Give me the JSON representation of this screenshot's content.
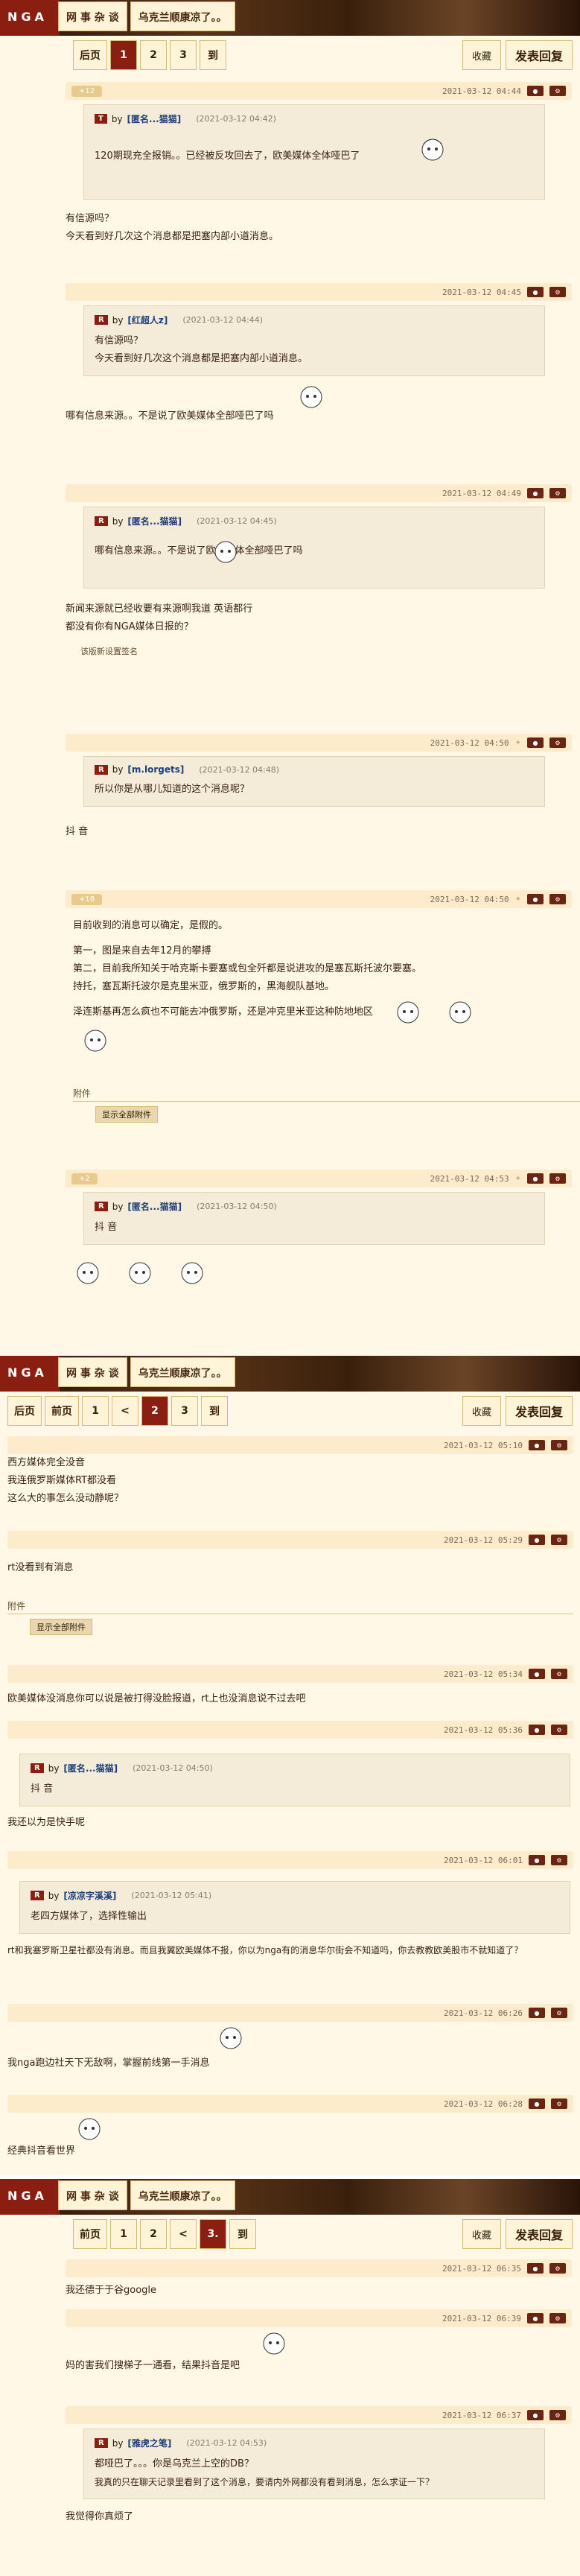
{
  "header": {
    "logo": "NGA",
    "breadcrumbs": [
      "网 事 杂 谈",
      "乌克兰顺康凉了。。"
    ]
  },
  "toolbar": {
    "fav": "收藏",
    "reply": "发表回复"
  },
  "pages": [
    {
      "items": [
        "后页",
        "1",
        "2",
        "3",
        "到"
      ],
      "current": "1"
    },
    {
      "items": [
        "后页",
        "前页",
        "1",
        "<",
        "2",
        "3",
        "到"
      ],
      "current": "2"
    },
    {
      "items": [
        "前页",
        "1",
        "2",
        "<",
        "3.",
        "到"
      ],
      "current": "3."
    }
  ],
  "posts": {
    "p1": {
      "tag": "+12",
      "ts": "2021-03-12 04:44",
      "quote_user": "[匿名...猫猫]",
      "quote_ts": "(2021-03-12 04:42)",
      "quote_text": "120期现充全报销。。已经被反攻回去了，欧美媒体全体哑巴了",
      "text1": "有信源吗？",
      "text2": "今天看到好几次这个消息都是把塞内部小道消息。"
    },
    "p2": {
      "ts": "2021-03-12 04:45",
      "quote_user": "[红超人z]",
      "quote_ts": "(2021-03-12 04:44)",
      "quote_text1": "有信源吗？",
      "quote_text2": "今天看到好几次这个消息都是把塞内部小道消息。",
      "text": "哪有信息来源。。不是说了欧美媒体全部哑巴了吗"
    },
    "p3": {
      "ts": "2021-03-12 04:49",
      "quote_user": "[匿名...猫猫]",
      "quote_ts": "(2021-03-12 04:45)",
      "quote_text": "哪有信息来源。。不是说了欧美媒体全部哑巴了吗",
      "text1": "新闻来源就已经收要有来源啊我道 英语都行",
      "text2": "都没有你有NGA媒体日报的？",
      "sig": "该版新设置签名"
    },
    "p4": {
      "ts": "2021-03-12 04:50",
      "quote_user": "[m.lorgets]",
      "quote_ts": "(2021-03-12 04:48)",
      "quote_text": "所以你是从哪儿知道的这个消息呢？",
      "text": "抖 音"
    },
    "p5": {
      "tag": "+18",
      "ts": "2021-03-12 04:50",
      "text1": "目前收到的消息可以确定，是假的。",
      "text2": "第一，图是来自去年12月的攀搏",
      "text3": "第二，目前我所知关于哈克斯卡要塞或包全歼都是说进攻的是塞瓦斯托波尔要塞。",
      "text4": "持托，塞瓦斯托波尔是克里米亚，俄罗斯的，黑海舰队基地。",
      "text5": "泽连斯基再怎么疯也不可能去冲俄罗斯，还是冲克里米亚这种防地地区",
      "attach": "附件",
      "show_att": "显示全部附件"
    },
    "p6": {
      "tag": "+2",
      "ts": "2021-03-12 04:53",
      "quote_user": "[匿名...猫猫]",
      "quote_ts": "(2021-03-12 04:50)",
      "quote_text": "抖 音"
    },
    "p7": {
      "ts": "2021-03-12 05:10",
      "text1": "西方媒体完全没音",
      "text2": "我连俄罗斯媒体RT都没看",
      "text3": "这么大的事怎么没动静呢？"
    },
    "p8": {
      "ts": "2021-03-12 05:29",
      "text": "rt没看到有消息",
      "attach": "附件",
      "show_att": "显示全部附件"
    },
    "p9": {
      "ts": "2021-03-12 05:34",
      "text": "欧美媒体没消息你可以说是被打得没脸报道，rt上也没消息说不过去吧"
    },
    "p10": {
      "ts": "2021-03-12 05:36",
      "quote_user": "[匿名...猫猫]",
      "quote_ts": "(2021-03-12 04:50)",
      "quote_text": "抖 音",
      "text": "我还以为是快手呢"
    },
    "p11": {
      "ts": "2021-03-12 06:01",
      "quote_user": "[凉凉字溪溪]",
      "quote_ts": "(2021-03-12 05:41)",
      "quote_text": "老四方媒体了，选择性输出",
      "text": "rt和我塞罗斯卫星社都没有消息。而且我翼欧美媒体不报，你以为nga有的消息华尔街会不知道吗，你去教教欧美股市不就知道了？"
    },
    "p12": {
      "ts": "2021-03-12 06:26",
      "text": "我nga跑边社天下无敌啊，掌握前线第一手消息"
    },
    "p13": {
      "ts": "2021-03-12 06:28",
      "text": "经典抖音看世界"
    },
    "p14": {
      "ts": "2021-03-12 06:35",
      "text": "我还德于于谷google"
    },
    "p15": {
      "ts": "2021-03-12 06:39",
      "text": "妈的害我们搜梯子一通看，结果抖音是吧"
    },
    "p16": {
      "ts": "2021-03-12 06:37",
      "quote_user": "[雅虎之笔]",
      "quote_ts": "(2021-03-12 04:53)",
      "quote_text1": "都哑巴了。。。你是乌克兰上空的DB？",
      "quote_text2": "我真的只在聊天记录里看到了这个消息，要请内外网都没有看到消息，怎么求证一下？",
      "text": "我觉得你真烦了"
    }
  },
  "colors": {
    "brand": "#8a1e10",
    "bg": "#fff8e7",
    "user": "#1d3e7a"
  }
}
